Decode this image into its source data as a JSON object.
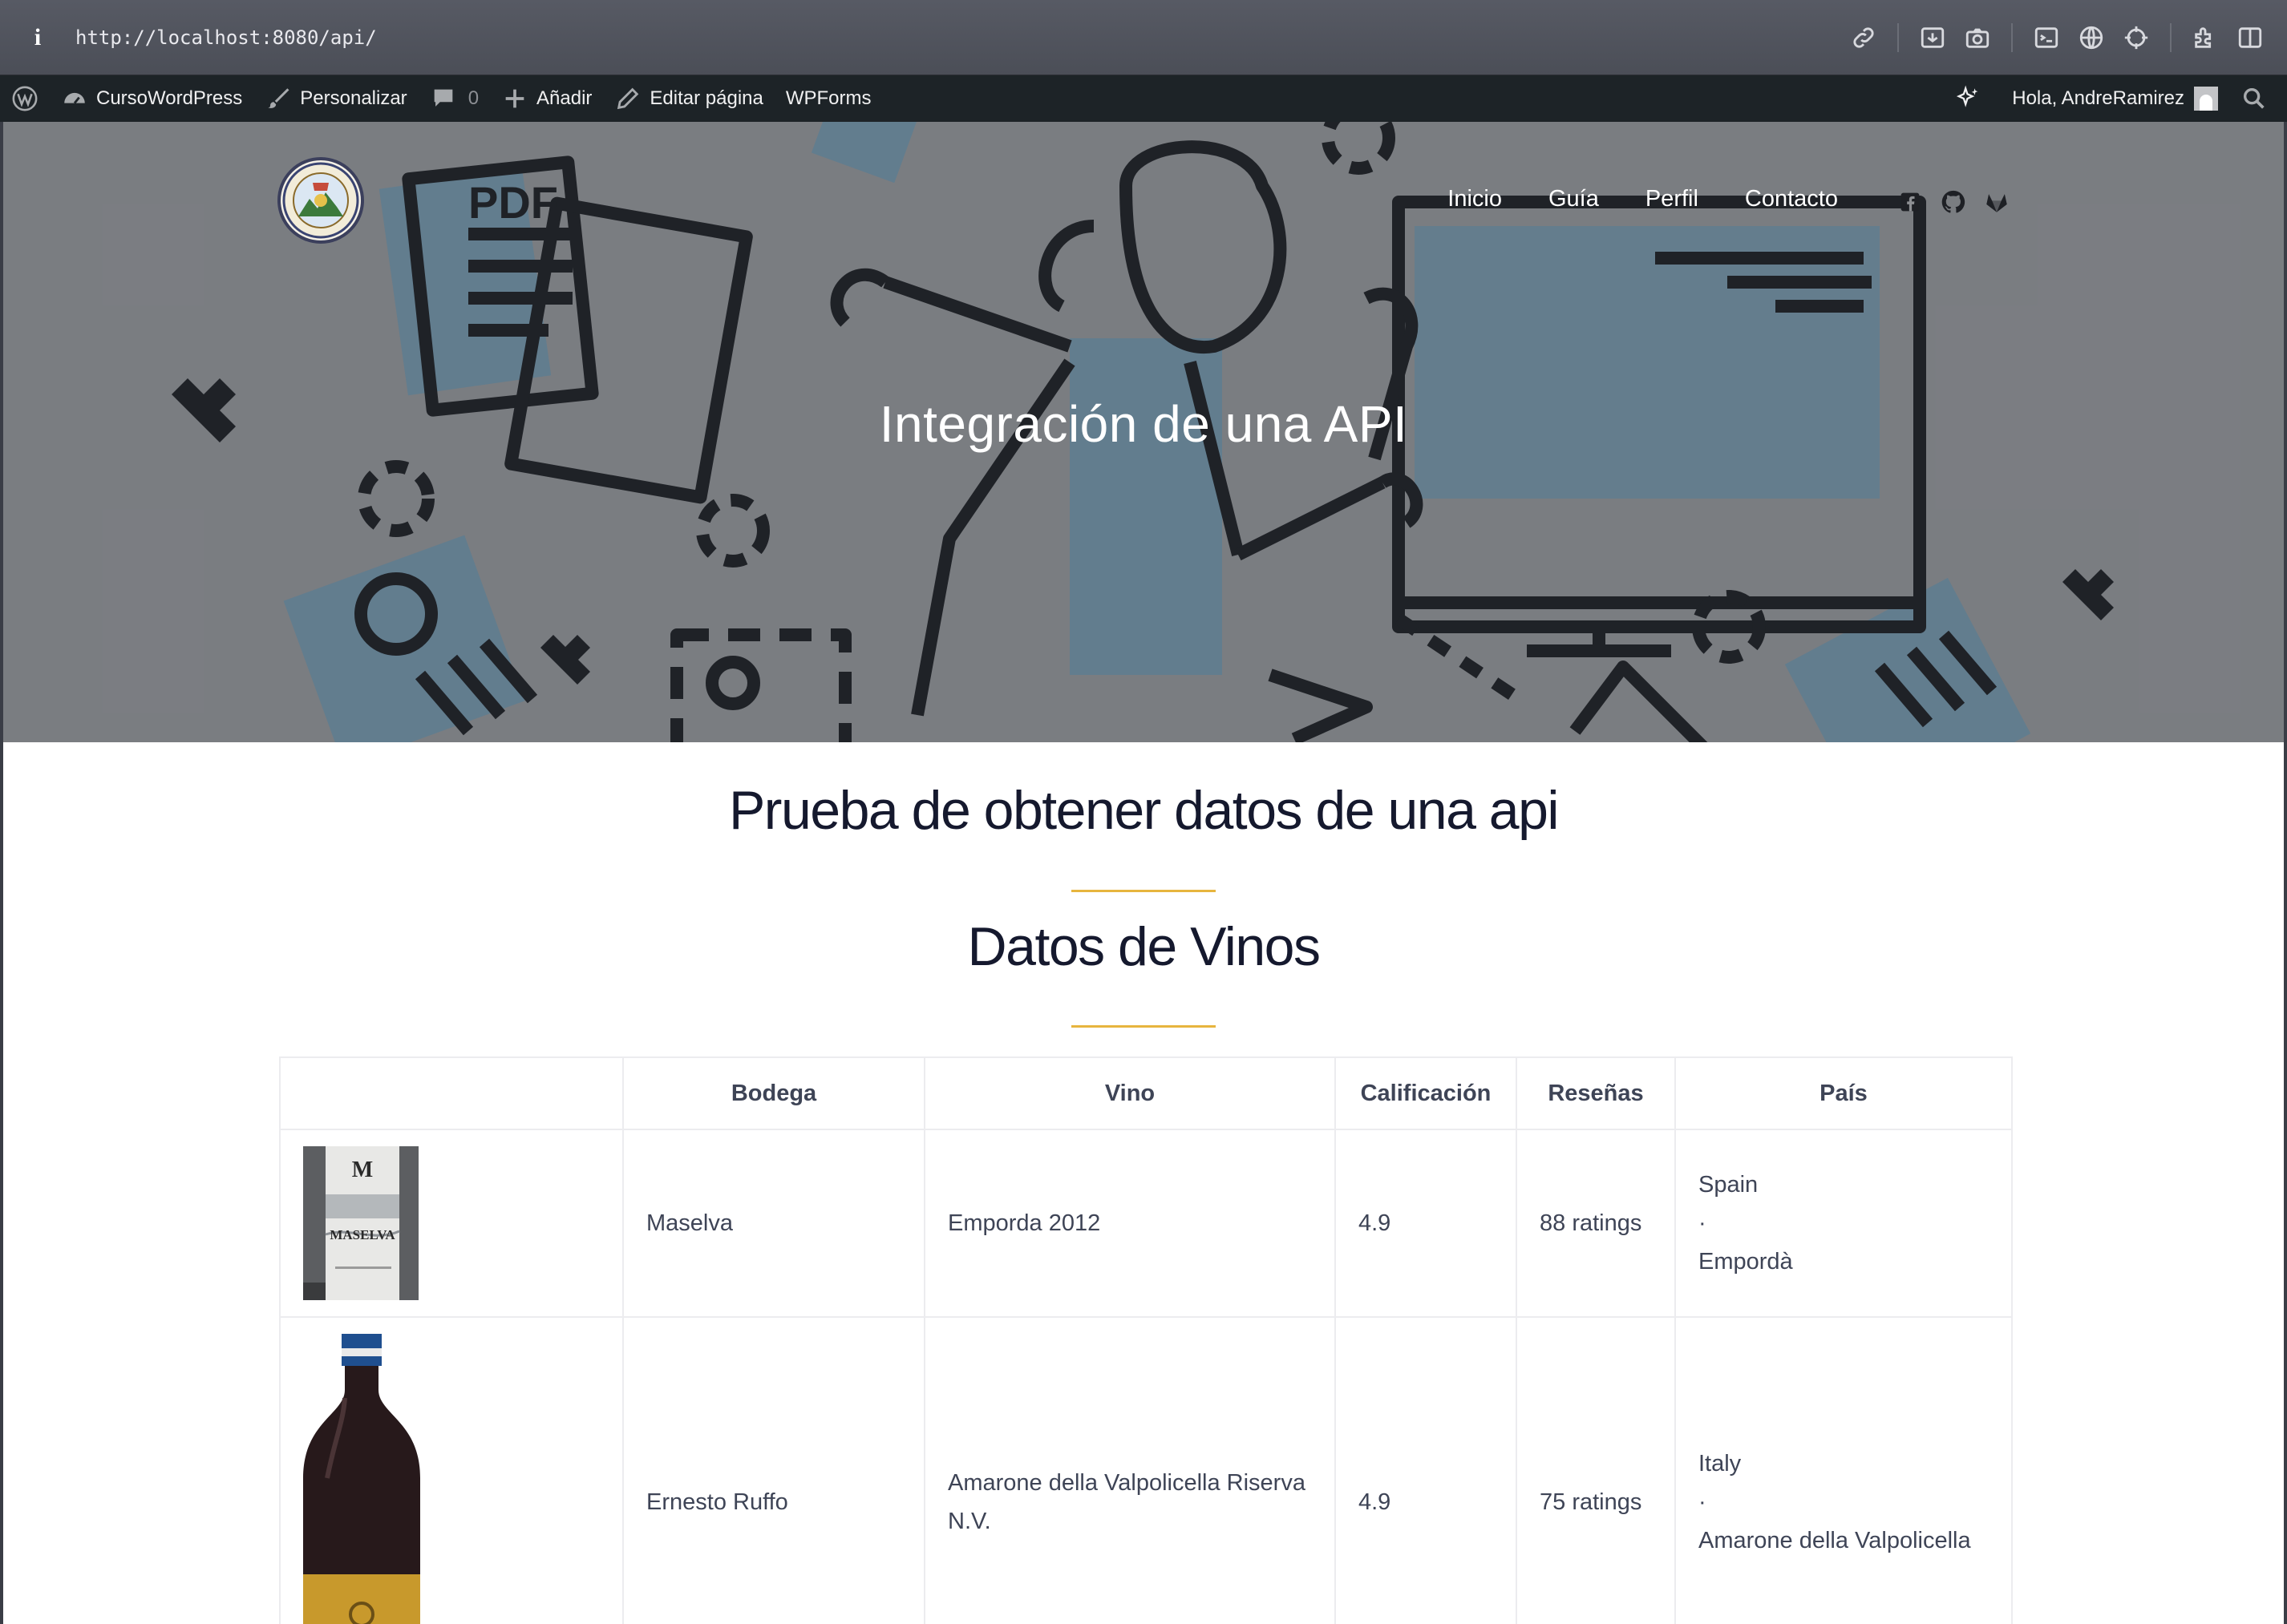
{
  "browser": {
    "url": "http://localhost:8080/api/"
  },
  "adminbar": {
    "site_name": "CursoWordPress",
    "customize": "Personalizar",
    "comments_count": "0",
    "add_new": "Añadir",
    "edit_page": "Editar página",
    "wpforms": "WPForms",
    "greeting": "Hola, AndreRamirez"
  },
  "header": {
    "nav": [
      "Inicio",
      "Guía",
      "Perfil",
      "Contacto"
    ],
    "social_icons": [
      "facebook-icon",
      "github-icon",
      "gitlab-icon"
    ]
  },
  "hero": {
    "title": "Integración de una API"
  },
  "main": {
    "heading": "Prueba de obtener datos de una api",
    "subheading": "Datos de Vinos"
  },
  "table": {
    "columns": [
      "",
      "Bodega",
      "Vino",
      "Calificación",
      "Reseñas",
      "País"
    ],
    "rows": [
      {
        "winery": "Maselva",
        "wine": "Emporda 2012",
        "rating": "4.9",
        "reviews": "88 ratings",
        "country": "Spain",
        "separator": "·",
        "region": "Empordà",
        "label_text": "MASELVA",
        "label_mark": "M"
      },
      {
        "winery": "Ernesto Ruffo",
        "wine": "Amarone della Valpolicella Riserva N.V.",
        "rating": "4.9",
        "reviews": "75 ratings",
        "country": "Italy",
        "separator": "·",
        "region": "Amarone della Valpolicella"
      }
    ]
  },
  "colors": {
    "accent": "#e7b53e",
    "heading": "#15192e",
    "adminbar": "#1d2327",
    "hero_blue": "#6f8fa3"
  }
}
